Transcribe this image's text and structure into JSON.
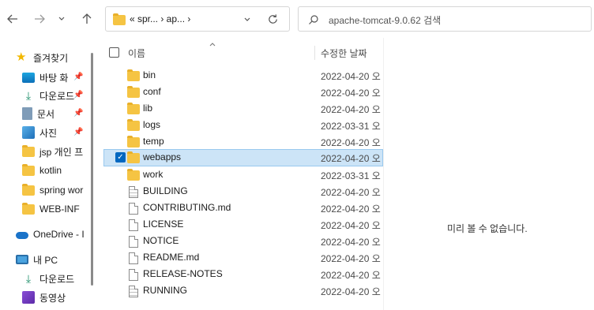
{
  "nav": {
    "back_icon": "arrow-left-icon",
    "forward_icon": "arrow-right-icon",
    "recent_icon": "chevron-down-icon",
    "up_icon": "arrow-up-icon",
    "address_text": "«  spr...  ›  ap...  ›",
    "refresh_icon": "refresh-icon",
    "search_placeholder": "apache-tomcat-9.0.62 검색"
  },
  "sidebar": {
    "quick_access": "즐겨찾기",
    "items": [
      {
        "label": "바탕 화",
        "icon": "desktop-icon",
        "pinned": true
      },
      {
        "label": "다운로드",
        "icon": "download-icon",
        "pinned": true
      },
      {
        "label": "문서",
        "icon": "document-icon",
        "pinned": true
      },
      {
        "label": "사진",
        "icon": "pictures-icon",
        "pinned": true
      },
      {
        "label": "jsp 개인 프",
        "icon": "folder-icon",
        "pinned": false
      },
      {
        "label": "kotlin",
        "icon": "folder-icon",
        "pinned": false
      },
      {
        "label": "spring wor",
        "icon": "folder-icon",
        "pinned": false
      },
      {
        "label": "WEB-INF",
        "icon": "folder-icon",
        "pinned": false
      }
    ],
    "onedrive": "OneDrive - I",
    "this_pc": "내 PC",
    "pc_items": [
      {
        "label": "다운로드",
        "icon": "download-icon"
      },
      {
        "label": "동영상",
        "icon": "video-icon"
      }
    ]
  },
  "list": {
    "col_name": "이름",
    "col_date": "수정한 날짜",
    "rows": [
      {
        "name": "bin",
        "type": "folder",
        "date": "2022-04-20 오"
      },
      {
        "name": "conf",
        "type": "folder",
        "date": "2022-04-20 오"
      },
      {
        "name": "lib",
        "type": "folder",
        "date": "2022-04-20 오"
      },
      {
        "name": "logs",
        "type": "folder",
        "date": "2022-03-31 오"
      },
      {
        "name": "temp",
        "type": "folder",
        "date": "2022-04-20 오"
      },
      {
        "name": "webapps",
        "type": "folder",
        "date": "2022-04-20 오",
        "selected": true
      },
      {
        "name": "work",
        "type": "folder",
        "date": "2022-03-31 오"
      },
      {
        "name": "BUILDING",
        "type": "textfile",
        "date": "2022-04-20 오"
      },
      {
        "name": "CONTRIBUTING.md",
        "type": "file",
        "date": "2022-04-20 오"
      },
      {
        "name": "LICENSE",
        "type": "file",
        "date": "2022-04-20 오"
      },
      {
        "name": "NOTICE",
        "type": "file",
        "date": "2022-04-20 오"
      },
      {
        "name": "README.md",
        "type": "file",
        "date": "2022-04-20 오"
      },
      {
        "name": "RELEASE-NOTES",
        "type": "file",
        "date": "2022-04-20 오"
      },
      {
        "name": "RUNNING",
        "type": "textfile",
        "date": "2022-04-20 오"
      }
    ]
  },
  "preview": {
    "empty_text": "미리 볼 수 없습니다."
  }
}
